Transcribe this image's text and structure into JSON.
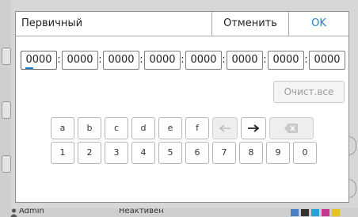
{
  "dialog": {
    "title": "Первичный",
    "cancel_label": "Отменить",
    "ok_label": "OK"
  },
  "address": {
    "fields": [
      "0000",
      "0000",
      "0000",
      "0000",
      "0000",
      "0000",
      "0000",
      "0000"
    ],
    "separator": ":",
    "active_field": 0
  },
  "clear_all_label": "Очист.все",
  "keypad": {
    "row1": [
      "a",
      "b",
      "c",
      "d",
      "e",
      "f"
    ],
    "row2": [
      "1",
      "2",
      "3",
      "4",
      "5",
      "6",
      "7",
      "8",
      "9",
      "0"
    ],
    "icons": {
      "left_arrow": "arrow-left-icon",
      "right_arrow": "arrow-right-icon",
      "backspace": "backspace-icon"
    },
    "left_arrow_enabled": false,
    "backspace_enabled": false
  },
  "status_bar": {
    "user": "Admin",
    "mode": "Неактивен"
  },
  "colors": {
    "accent": "#1e7fcf",
    "disabled_text": "#9c9c9c"
  }
}
